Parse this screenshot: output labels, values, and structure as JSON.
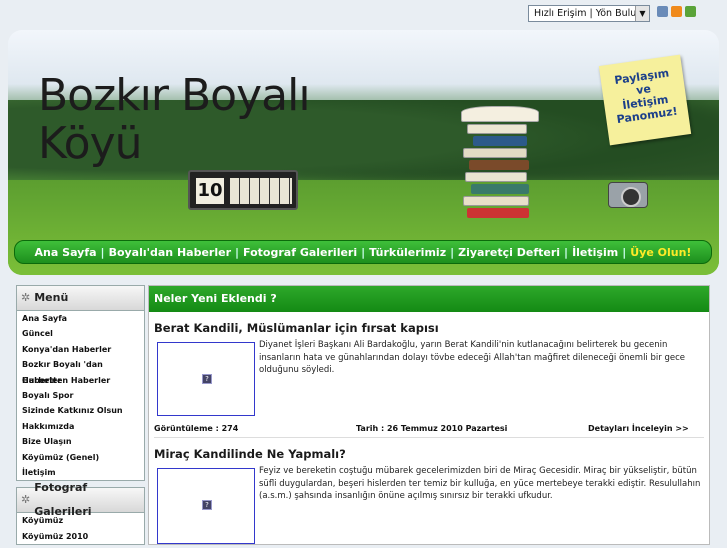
{
  "quick_access": {
    "label": "Hızlı Erişim | Yön Bulucu"
  },
  "site": {
    "title_line1": "Bozkır Boyalı",
    "title_line2": "Köyü",
    "calendar_day": "10"
  },
  "note": {
    "text_1": "Paylaşım",
    "text_2": "ve",
    "text_3": "İletişim",
    "text_4": "Panomuz!"
  },
  "nav": {
    "items": [
      "Ana Sayfa",
      "Boyalı'dan Haberler",
      "Fotograf Galerileri",
      "Türkülerimiz",
      "Ziyaretçi Defteri",
      "İletişim"
    ],
    "highlight": "Üye Olun!",
    "separator": "|"
  },
  "sidebar": {
    "menu_title": "Menü",
    "menu_items": [
      "Ana Sayfa",
      "Güncel",
      "Konya'dan Haberler",
      "Bozkır Boyalı 'dan Haberler",
      "Gurbetten Haberler",
      "Boyalı Spor",
      "Sizinde Katkınız Olsun",
      "Hakkımızda",
      "Bize Ulaşın",
      "Köyümüz (Genel)",
      "İletişim"
    ],
    "gallery_title": "Fotograf Galerileri",
    "gallery_items": [
      "Köyümüz",
      "Köyümüz 2010"
    ]
  },
  "main": {
    "header": "Neler Yeni Eklendi ?",
    "articles": [
      {
        "title": "Berat Kandili, Müslümanlar için fırsat kapısı",
        "text": "Diyanet İşleri Başkanı Ali Bardakoğlu, yarın Berat Kandili'nin kutlanacağını belirterek bu gecenin insanların hata ve günahlarından dolayı tövbe edeceği Allah'tan mağfiret dileneceği önemli bir gece olduğunu söyledi.",
        "views": "Görüntüleme : 274",
        "date": "Tarih : 26 Temmuz 2010 Pazartesi",
        "more": "Detayları İnceleyin >>",
        "image_alt": "?"
      },
      {
        "title": "Miraç Kandilinde Ne Yapmalı?",
        "text": "Feyiz ve bereketin coştuğu mübarek gecelerimizden biri de Miraç Gecesidir. Miraç bir yükseliştir, bütün süfli duygulardan, beşeri hislerden ter temiz bir kulluğa, en yüce mertebeye terakki ediştir. Resulullahın (a.s.m.) şahsında insanlığın önüne açılmış sınırsız bir terakki ufkudur.",
        "image_alt": "?"
      }
    ]
  }
}
